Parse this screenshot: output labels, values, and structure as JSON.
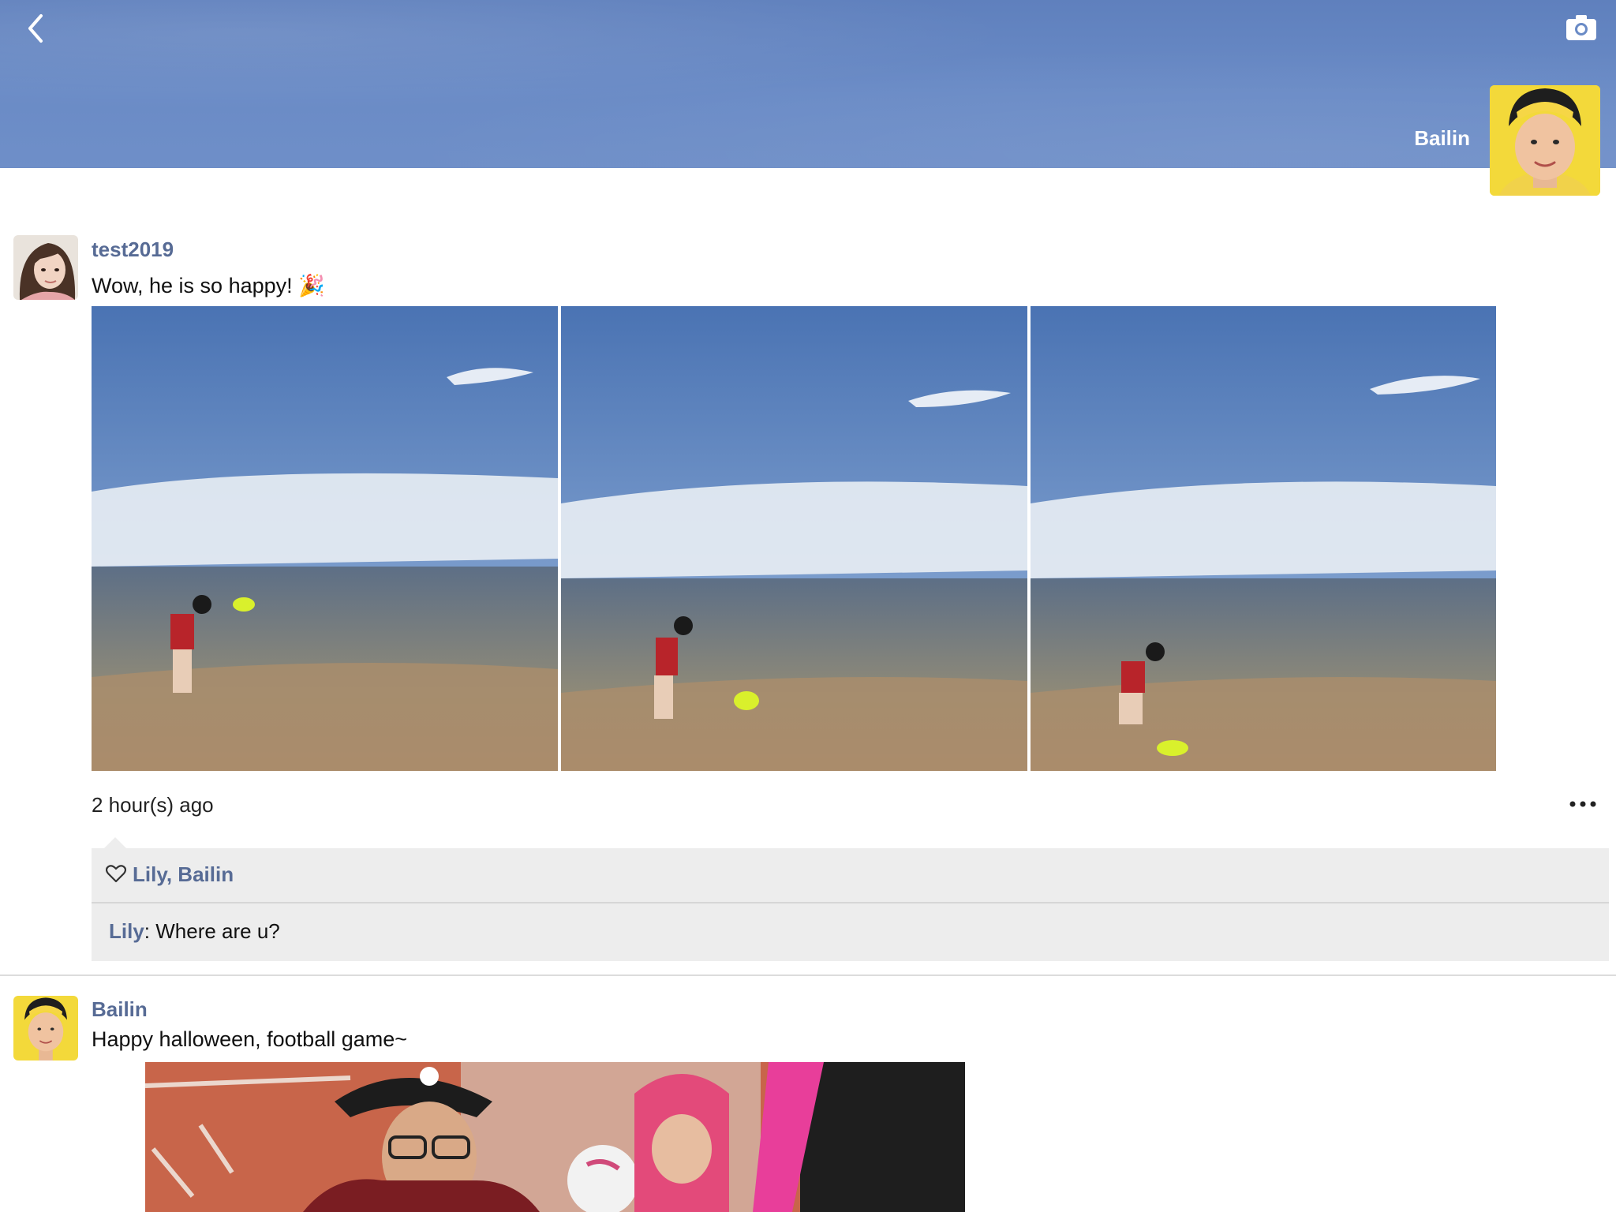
{
  "header": {
    "owner_name": "Bailin",
    "back_icon": "chevron-left-icon",
    "camera_icon": "camera-icon"
  },
  "posts": [
    {
      "username": "test2019",
      "text": "Wow, he is so happy! 🎉",
      "photos": [
        "beach-photo-1",
        "beach-photo-2",
        "beach-photo-3"
      ],
      "time": "2 hour(s) ago",
      "more_icon": "more-dots-icon",
      "likes": "Lily, Bailin",
      "comments": [
        {
          "author": "Lily",
          "text": ": Where are u?"
        }
      ]
    },
    {
      "username": "Bailin",
      "text": "Happy halloween, football game~",
      "photos": [
        "halloween-photo"
      ]
    }
  ],
  "colors": {
    "link": "#576b95",
    "cover": "#6a8bc6",
    "interaction_bg": "#ededed"
  }
}
